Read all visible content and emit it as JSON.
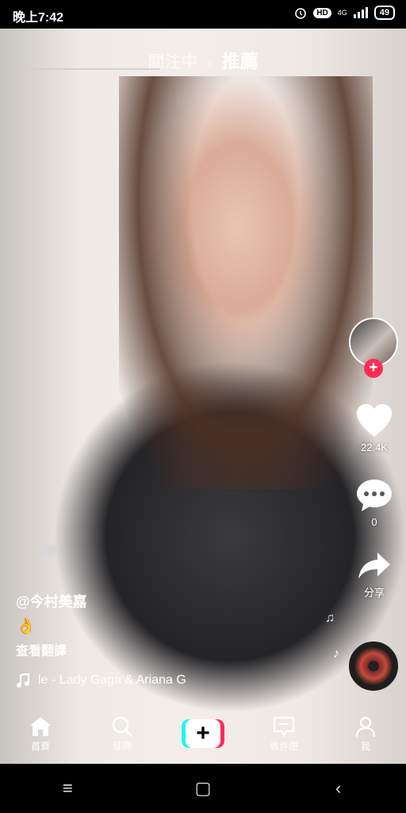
{
  "status_bar": {
    "time": "晚上7:42",
    "hd_label": "HD",
    "network_label": "4G",
    "battery": "49"
  },
  "top_tabs": {
    "following": "關注中",
    "recommended": "推薦"
  },
  "right_rail": {
    "likes": "22.4K",
    "comments": "0",
    "share_label": "分享"
  },
  "post": {
    "username": "@今村美嘉",
    "caption_emoji": "👌",
    "translate_label": "查看翻譯",
    "song": "le - Lady Gaga & Ariana G"
  },
  "bottom_nav": {
    "home": "首頁",
    "discover": "發現",
    "create": "+",
    "inbox": "收件匣",
    "me": "我"
  },
  "colors": {
    "accent_red": "#fe2c55",
    "accent_cyan": "#25f4ee"
  }
}
